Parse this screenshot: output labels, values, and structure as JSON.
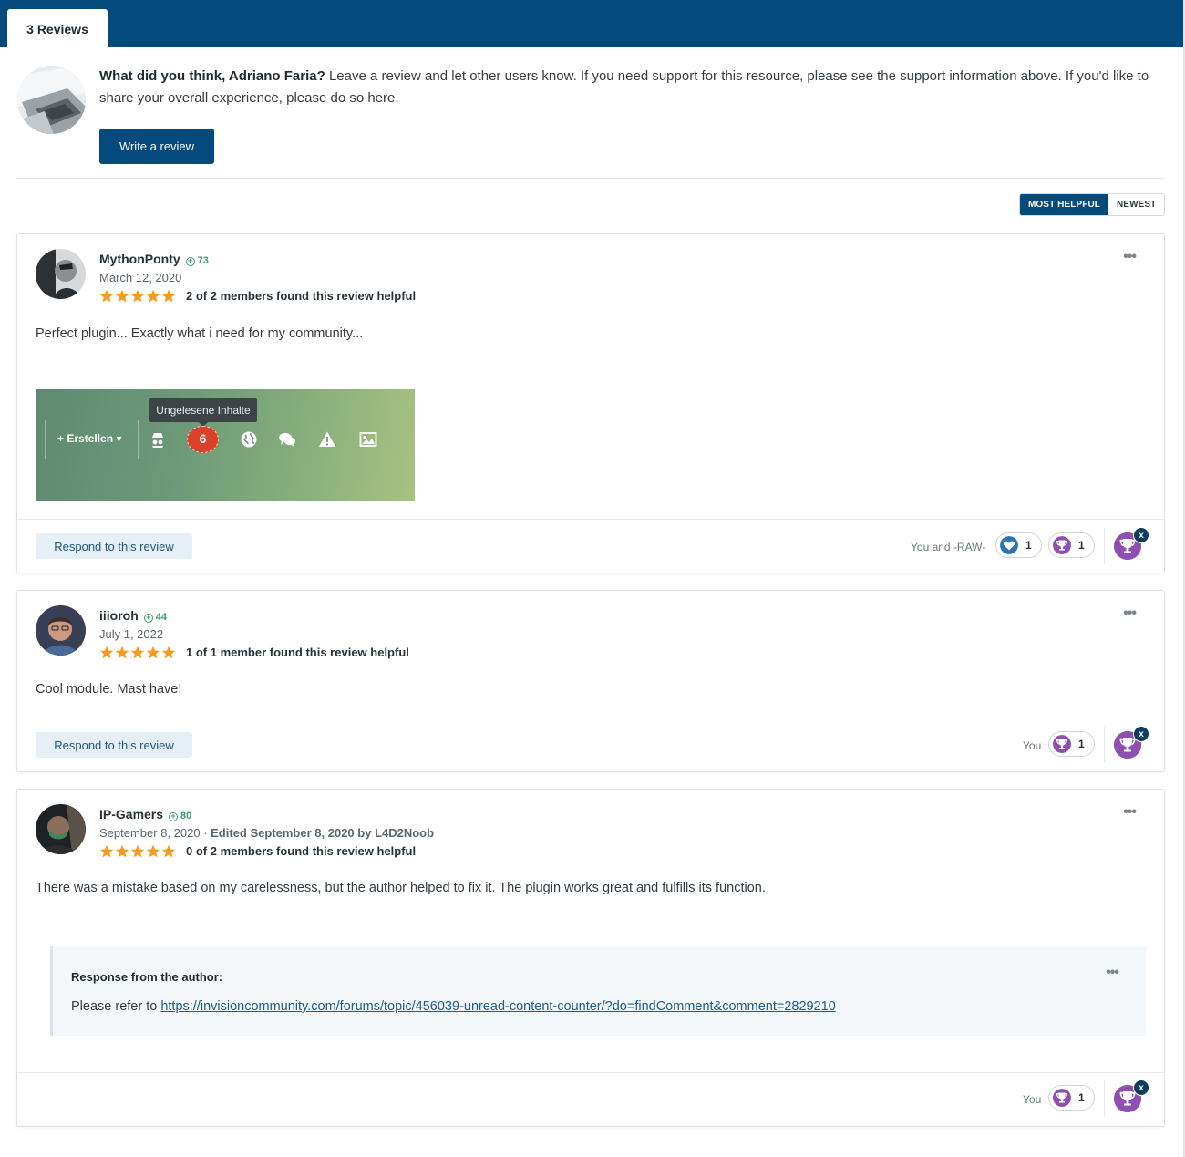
{
  "tab": {
    "label": "3 Reviews"
  },
  "prompt": {
    "greeting": "What did you think, Adriano Faria?",
    "text": " Leave a review and let other users know. If you need support for this resource, please see the support information above. If you'd like to share your overall experience, please do so here.",
    "write_button": "Write a review"
  },
  "sort": {
    "most_helpful": "MOST HELPFUL",
    "newest": "NEWEST",
    "active": "most_helpful"
  },
  "reviews": [
    {
      "author": "MythonPonty",
      "reputation": "73",
      "date": "March 12, 2020",
      "rating": 5,
      "helpful": "2 of 2 members found this review helpful",
      "body": "Perfect plugin... Exactly what i need for my community...",
      "attachment": {
        "tooltip": "Ungelesene Inhalte",
        "create_label": "Erstellen",
        "badge_count": "6"
      },
      "respond_label": "Respond to this review",
      "reacted_by": "You and -RAW-",
      "reactions": [
        {
          "icon": "heart-reaction-icon",
          "count": "1",
          "color": "#2d74b6"
        },
        {
          "icon": "trophy-reaction-icon",
          "count": "1",
          "color": "#8e4fb0"
        }
      ]
    },
    {
      "author": "iiioroh",
      "reputation": "44",
      "date": "July 1, 2022",
      "rating": 5,
      "helpful": "1 of 1 member found this review helpful",
      "body": "Cool module. Mast have!",
      "respond_label": "Respond to this review",
      "reacted_by": "You",
      "reactions": [
        {
          "icon": "trophy-reaction-icon",
          "count": "1",
          "color": "#8e4fb0"
        }
      ]
    },
    {
      "author": "IP-Gamers",
      "reputation": "80",
      "date": "September 8, 2020",
      "edited": "Edited September 8, 2020 by",
      "edited_by": "L4D2Noob",
      "rating": 5,
      "helpful": "0 of 2 members found this review helpful",
      "body": "There was a mistake based on my carelessness, but the author helped to fix it. The plugin works great and fulfills its function.",
      "response": {
        "title": "Response from the author:",
        "prefix": "Please refer to ",
        "link": "https://invisioncommunity.com/forums/topic/456039-unread-content-counter/?do=findComment&comment=2829210"
      },
      "reacted_by": "You",
      "reactions": [
        {
          "icon": "trophy-reaction-icon",
          "count": "1",
          "color": "#8e4fb0"
        }
      ]
    }
  ],
  "colors": {
    "brand": "#044a7c",
    "star": "#f79a1f",
    "reputation": "#3b9a6b",
    "trophy": "#8e4fb0"
  }
}
